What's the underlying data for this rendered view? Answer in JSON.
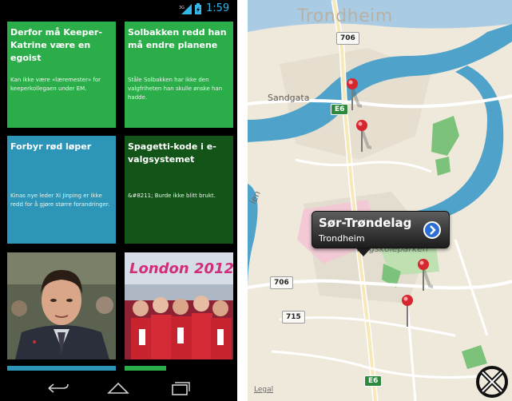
{
  "status_bar": {
    "network": "3G",
    "time": "1:59",
    "accent_color": "#33b5e5"
  },
  "news_tiles": [
    {
      "title": "Derfor må Keeper-Katrine være en egoist",
      "description": "Kan ikke være «læremester» for keeperkollegaen under EM.",
      "color": "#2bae4a"
    },
    {
      "title": "Solbakken redd han må endre planene",
      "description": "Ståle Solbakken har ikke den valgfriheten han skulle ønske han hadde.",
      "color": "#2bae4a"
    },
    {
      "title": "Forbyr rød løper",
      "description": "Kinas nye leder Xi Jinping er ikke redd for å gjøre større forandringer.",
      "color": "#2c95b8"
    },
    {
      "title": "Spagetti-kode i e-valgsystemet",
      "description": "&#8211; Burde ikke blitt brukt.",
      "color": "#135518"
    }
  ],
  "photo_tiles": [
    {
      "caption_logo": ""
    },
    {
      "caption_logo": "London 2012"
    }
  ],
  "nav_bar": {
    "back_icon": "back-arrow-icon",
    "home_icon": "home-icon",
    "recent_icon": "recent-apps-icon"
  },
  "map": {
    "city_label": "Trondheim",
    "street_sandgata": "Sandgata",
    "street_hogskoleparken": "Høgskoleparken",
    "street_partial": "ien",
    "route_706_top": "706",
    "route_706_left": "706",
    "route_715": "715",
    "e6_top": "E6",
    "e6_bottom": "E6",
    "legal": "Legal",
    "callout": {
      "title": "Sør-Trøndelag",
      "subtitle": "Trondheim"
    },
    "pin_color": "#d7272e",
    "river_color": "#4fa2c9",
    "park_color": "#7cc27a"
  }
}
